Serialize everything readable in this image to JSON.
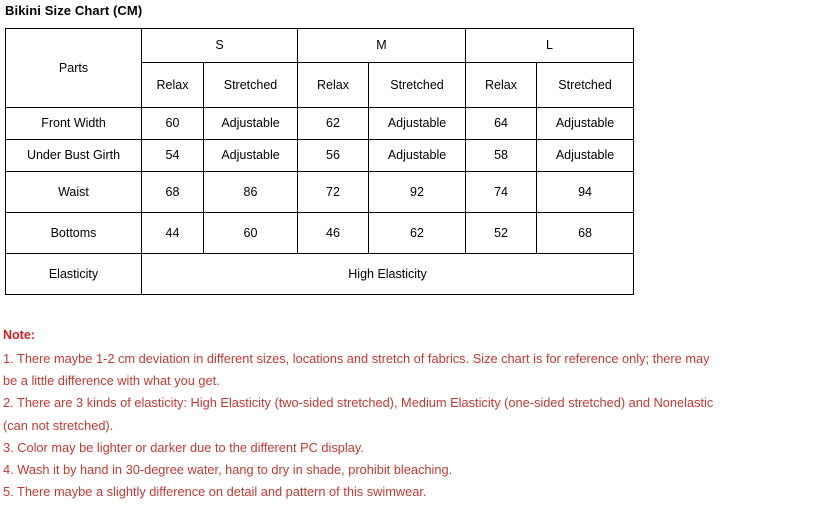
{
  "title": "Bikini Size Chart (CM)",
  "table": {
    "parts_header": "Parts",
    "sizes": [
      {
        "label": "S",
        "sub": [
          "Relax",
          "Stretched"
        ]
      },
      {
        "label": "M",
        "sub": [
          "Relax",
          "Stretched"
        ]
      },
      {
        "label": "L",
        "sub": [
          "Relax",
          "Stretched"
        ]
      }
    ],
    "rows": [
      {
        "part": "Front Width",
        "values": [
          "60",
          "Adjustable",
          "62",
          "Adjustable",
          "64",
          "Adjustable"
        ]
      },
      {
        "part": "Under Bust Girth",
        "values": [
          "54",
          "Adjustable",
          "56",
          "Adjustable",
          "58",
          "Adjustable"
        ]
      },
      {
        "part": "Waist",
        "values": [
          "68",
          "86",
          "72",
          "92",
          "74",
          "94"
        ]
      },
      {
        "part": "Bottoms",
        "values": [
          "44",
          "60",
          "46",
          "62",
          "52",
          "68"
        ]
      }
    ],
    "elasticity_row": {
      "part": "Elasticity",
      "value": "High Elasticity"
    }
  },
  "note": {
    "heading": "Note:",
    "lines": [
      "1. There maybe 1-2 cm deviation in different sizes, locations and stretch of fabrics. Size chart is for reference only; there may",
      "be a little difference with what you get.",
      "2. There are 3 kinds of elasticity: High Elasticity (two-sided stretched), Medium Elasticity (one-sided stretched) and Nonelastic",
      "(can not stretched).",
      "3. Color may be lighter or darker due to the different PC display.",
      "4. Wash it by hand in 30-degree water, hang to dry in shade, prohibit bleaching.",
      "5. There maybe a slightly difference on detail and pattern of this swimwear."
    ]
  },
  "colors": {
    "note_heading": "#cc2222",
    "note_body": "#bf3b34",
    "table_border": "#000000",
    "text": "#000000",
    "background": "#ffffff"
  }
}
